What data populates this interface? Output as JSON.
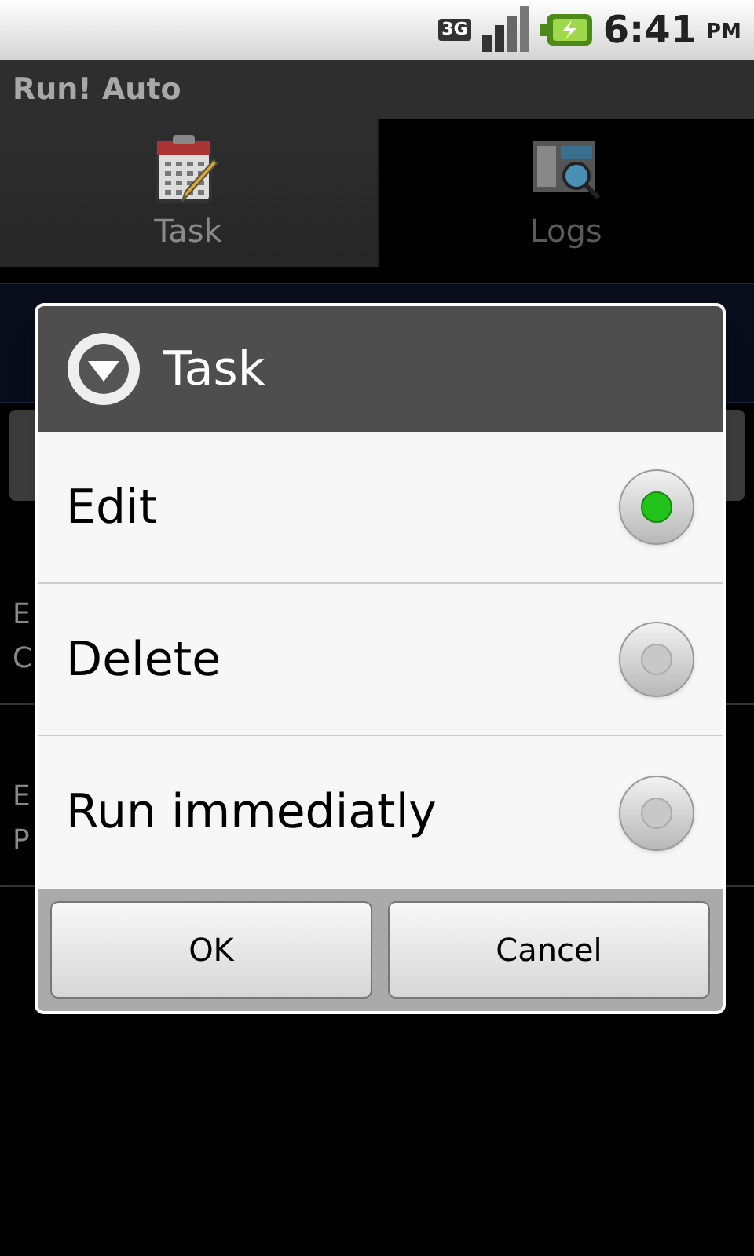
{
  "status_bar": {
    "network": "3G",
    "time": "6:41",
    "ampm": "PM"
  },
  "title_bar": {
    "title": "Run! Auto"
  },
  "tabs": [
    {
      "label": "Task",
      "selected": true
    },
    {
      "label": "Logs",
      "selected": false
    }
  ],
  "rows": [
    {
      "line_1": "E",
      "line_2": "C"
    },
    {
      "line_1": "E",
      "line_2": "P"
    }
  ],
  "dialog": {
    "title": "Task",
    "options": [
      {
        "label": "Edit",
        "selected": true
      },
      {
        "label": "Delete",
        "selected": false
      },
      {
        "label": "Run immediatly",
        "selected": false
      }
    ],
    "buttons": [
      "OK",
      "Cancel"
    ]
  }
}
